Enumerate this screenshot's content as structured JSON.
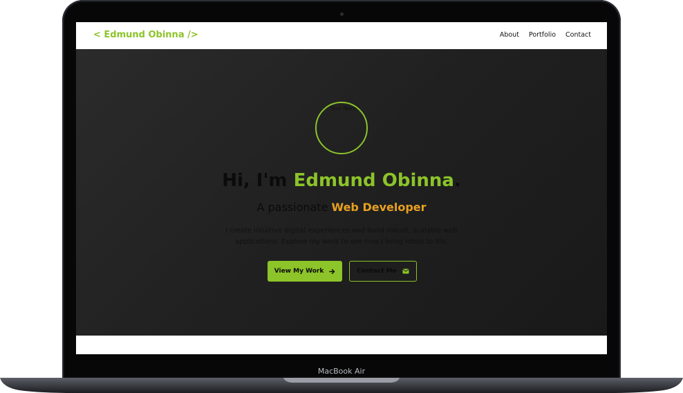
{
  "device": {
    "model_label": "MacBook Air"
  },
  "site": {
    "brand": "< Edmund Obinna />",
    "nav": [
      {
        "label": "About"
      },
      {
        "label": "Portfolio"
      },
      {
        "label": "Contact"
      }
    ]
  },
  "hero": {
    "avatar_alt": "Your Nam",
    "greeting": "Hi, I'm ",
    "name": "Edmund Obinna",
    "period": ".",
    "subtitle_prefix": "A passionate ",
    "role": "Web Developer",
    "description": "I create intuitive digital experiences and build robust, scalable web applications. Explore my work to see how I bring ideas to life.",
    "primary_button": {
      "label": "View My Work",
      "icon": "arrow-right-icon"
    },
    "secondary_button": {
      "label": "Contact Me",
      "icon": "envelope-icon"
    }
  },
  "colors": {
    "accent_green": "#8cc429",
    "accent_orange": "#e7a021",
    "hero_background": "#222222",
    "bezel": "#070707"
  }
}
